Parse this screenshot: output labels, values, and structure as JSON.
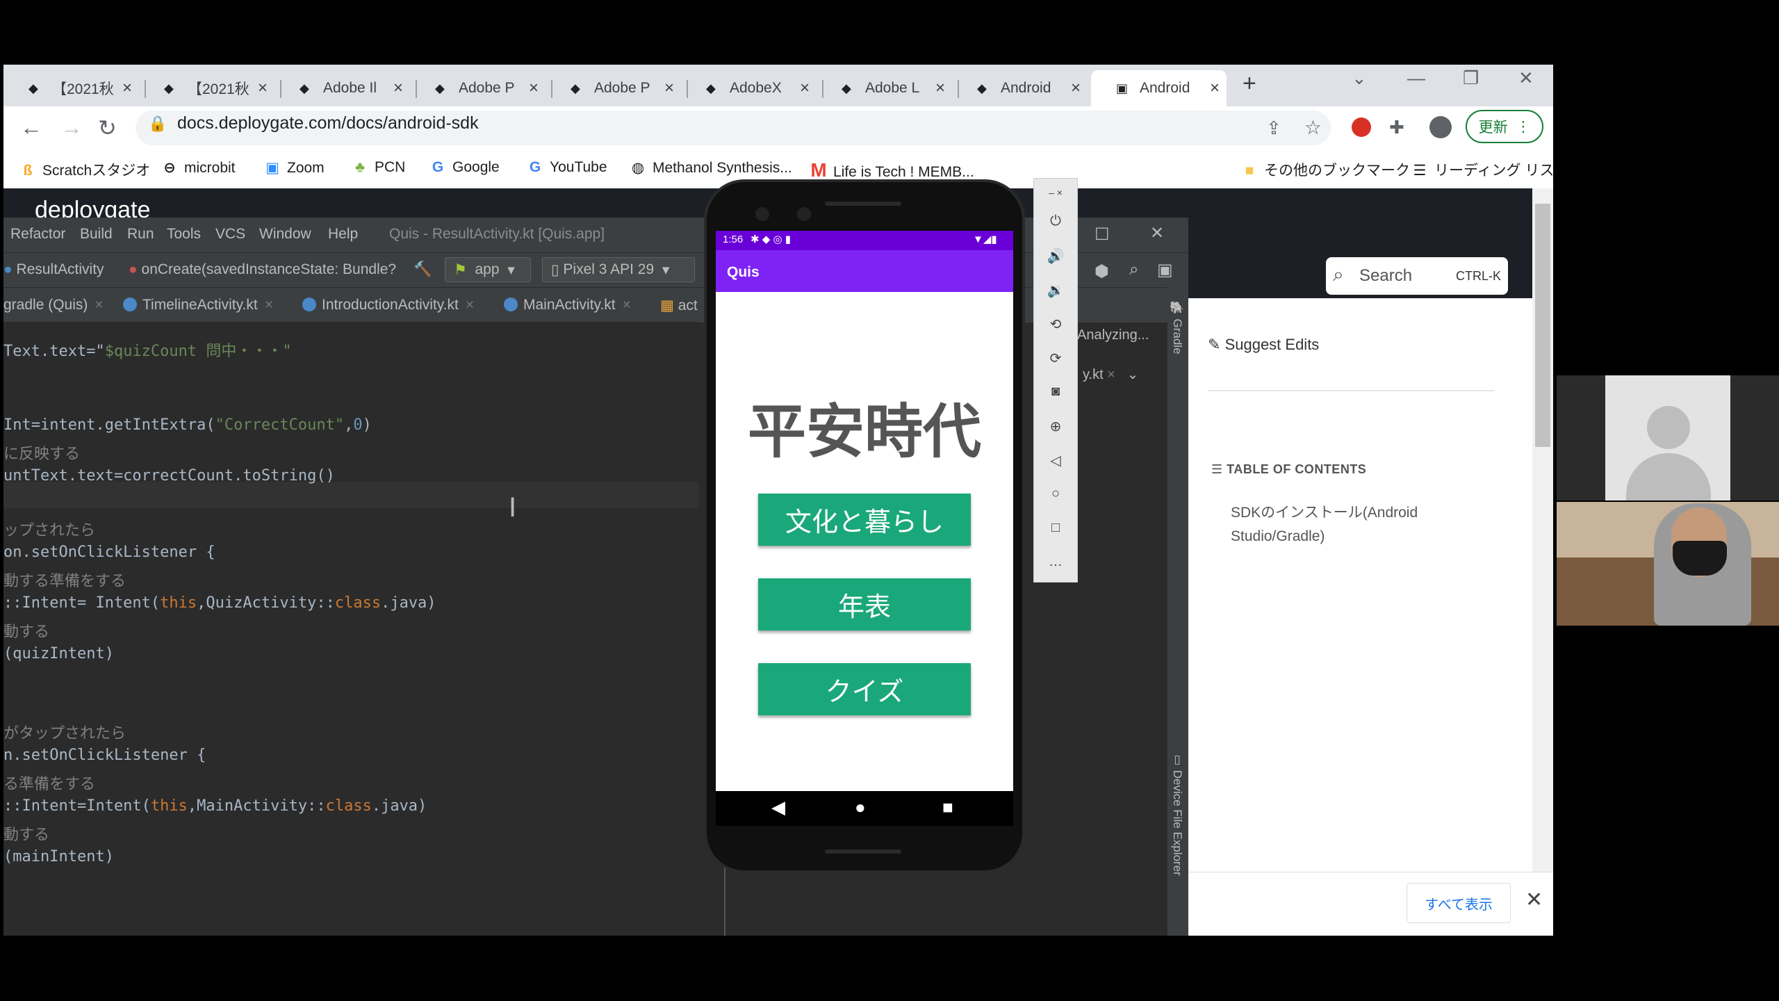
{
  "browser": {
    "tabs": [
      {
        "title": "【2021秋"
      },
      {
        "title": "【2021秋"
      },
      {
        "title": "Adobe Il"
      },
      {
        "title": "Adobe P"
      },
      {
        "title": "Adobe P"
      },
      {
        "title": "AdobeX"
      },
      {
        "title": "Adobe L"
      },
      {
        "title": "Android"
      },
      {
        "title": "Android"
      }
    ],
    "url": "docs.deploygate.com/docs/android-sdk",
    "update_label": "更新",
    "bookmarks": [
      "Scratchスタジオ",
      "microbit",
      "Zoom",
      "PCN",
      "Google",
      "YouTube",
      "Methanol Synthesis...",
      "Life is Tech ! MEMB..."
    ],
    "other_bookmarks": "その他のブックマーク",
    "reading_list": "リーディング リスト"
  },
  "page": {
    "logo": "deploygate",
    "search_placeholder": "Search",
    "search_shortcut": "CTRL-K",
    "suggest_edits": "Suggest Edits",
    "toc_heading": "TABLE OF CONTENTS",
    "toc_item": "SDKのインストール(Android Studio/Gradle)",
    "show_all": "すべて表示"
  },
  "ide": {
    "menu": [
      "Refactor",
      "Build",
      "Run",
      "Tools",
      "VCS",
      "Window",
      "Help"
    ],
    "title": "Quis - ResultActivity.kt [Quis.app]",
    "nav_class": "ResultActivity",
    "nav_method": "onCreate(savedInstanceState: Bundle?",
    "run_config": "app",
    "device": "Pixel 3 API 29",
    "tabs": [
      "gradle (Quis)",
      "TimelineActivity.kt",
      "IntroductionActivity.kt",
      "MainActivity.kt",
      "act"
    ],
    "right_tab_suffix": "y.kt",
    "analyzing": "Analyzing...",
    "gradle_label": "Gradle",
    "device_explorer_label": "Device File Explorer",
    "code": {
      "l1a": "Text.text=\"",
      "l1b": "$quizCount",
      "l1c": " 問中・・・\"",
      "l2a": "Int=intent.getIntExtra(",
      "l2b": "\"CorrectCount\"",
      "l2c": ",",
      "l2d": "0",
      "l2e": ")",
      "l3": "に反映する",
      "l4": "untText.text=correctCount.toString()",
      "l5": "ップされたら",
      "l6": "on.setOnClickListener {",
      "l7": "動する準備をする",
      "l8a": "::Intent= Intent(",
      "l8b": "this",
      "l8c": ",QuizActivity::",
      "l8d": "class",
      "l8e": ".java)",
      "l9": "動する",
      "l10": "(quizIntent)",
      "l11": "がタップされたら",
      "l12": "n.setOnClickListener {",
      "l13": "る準備をする",
      "l14a": "::Intent=Intent(",
      "l14b": "this",
      "l14c": ",MainActivity::",
      "l14d": "class",
      "l14e": ".java)",
      "l15": "動する",
      "l16": "(mainIntent)"
    }
  },
  "emulator": {
    "time": "1:56",
    "app_title": "Quis",
    "heading": "平安時代",
    "buttons": [
      "文化と暮らし",
      "年表",
      "クイズ"
    ]
  },
  "colors": {
    "app_bar": "#7e22f5",
    "button": "#1aa87a",
    "ide_bg": "#2b2b2b"
  }
}
